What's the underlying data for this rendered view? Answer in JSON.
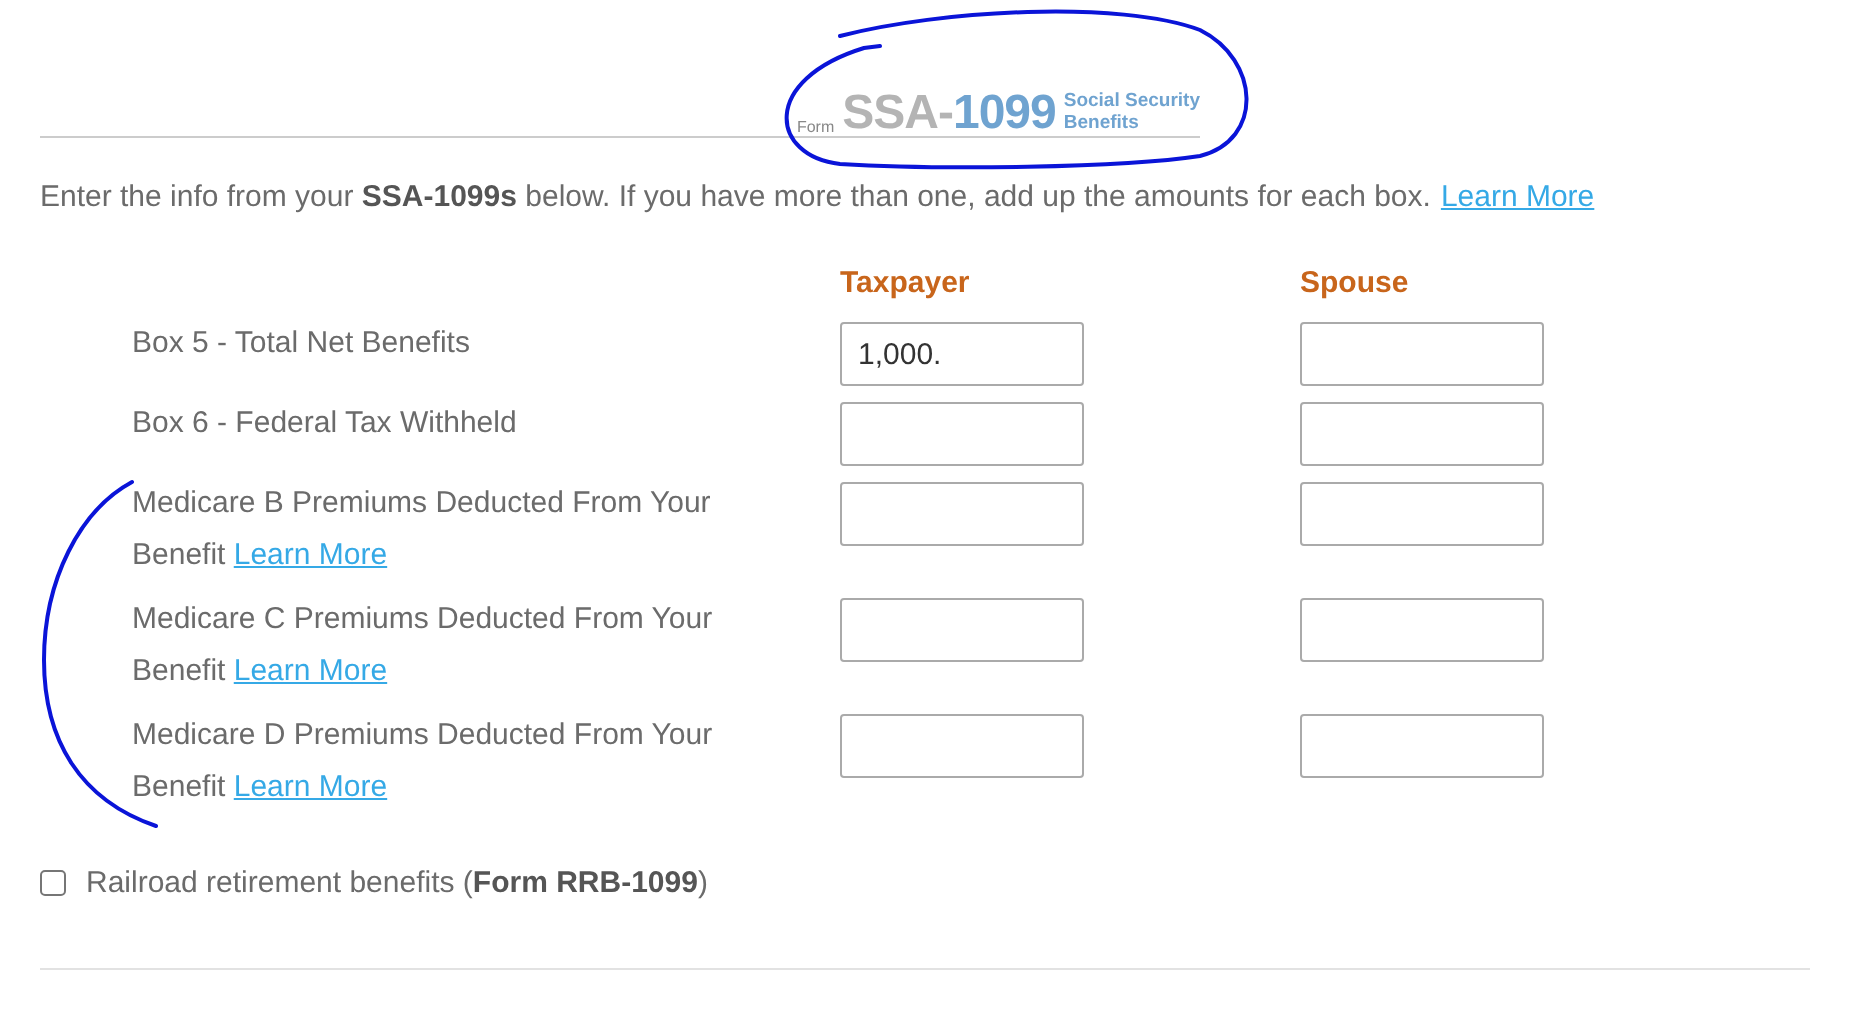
{
  "form_logo": {
    "prefix": "Form",
    "number_prefix": "SSA-",
    "number": "1099",
    "subtitle_line1": "Social Security",
    "subtitle_line2": "Benefits"
  },
  "intro": {
    "text": "Enter the info from your **SSA-1099s** below. If you have more than one, add up the amounts for each box.",
    "link": "Learn More"
  },
  "columns": [
    "Taxpayer",
    "Spouse"
  ],
  "rows": [
    {
      "label": "Box 5 - Total Net Benefits",
      "taxpayer": "1,000.",
      "spouse": ""
    },
    {
      "label": "Box 6 - Federal Tax Withheld",
      "taxpayer": "",
      "spouse": ""
    },
    {
      "label": "Medicare B Premiums Deducted From Your Benefit",
      "link": "Learn More",
      "taxpayer": "",
      "spouse": ""
    },
    {
      "label": "Medicare C Premiums Deducted From Your Benefit",
      "link": "Learn More",
      "taxpayer": "",
      "spouse": ""
    },
    {
      "label": "Medicare D Premiums Deducted From Your Benefit",
      "link": "Learn More",
      "taxpayer": "",
      "spouse": ""
    }
  ],
  "railroad": {
    "label": "Railroad retirement benefits (**Form RRB-1099**)",
    "checked": false
  }
}
